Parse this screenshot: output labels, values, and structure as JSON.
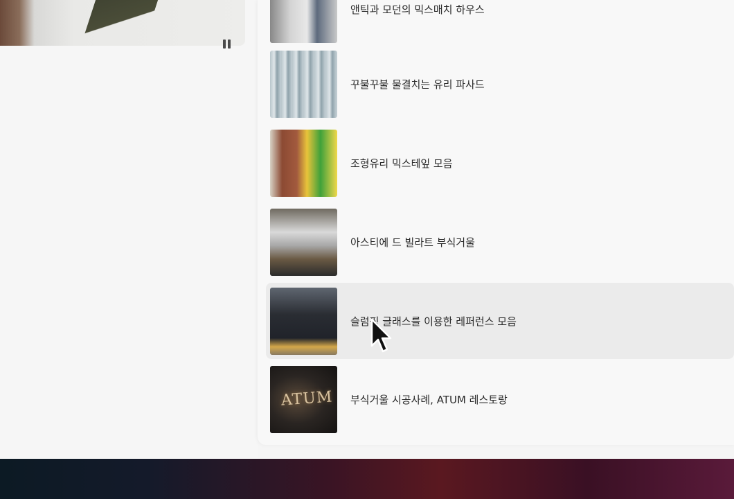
{
  "list": {
    "items": [
      {
        "label": "앤틱과 모던의 믹스매치 하우스",
        "thumb": "kitchen-image"
      },
      {
        "label": "꾸불꾸불 물결치는 유리 파사드",
        "thumb": "glass-facade-image"
      },
      {
        "label": "조형유리 믹스테잎 모음",
        "thumb": "color-glass-image"
      },
      {
        "label": "아스티에 드 빌라트 부식거울",
        "thumb": "shelf-mirror-image"
      },
      {
        "label": "슬럼핑 글래스를 이용한 레퍼런스 모음",
        "thumb": "building-image"
      },
      {
        "label": "부식거울 시공사례, ATUM 레스토랑",
        "thumb": "atum-sign-image"
      }
    ],
    "hovered_index": 4
  },
  "atum_logo": "ATUM",
  "video": {
    "control_icon": "pause-icon"
  },
  "colors": {
    "panel": "#f8f8f8",
    "hover": "#ebebeb",
    "text": "#2a2a2a"
  }
}
